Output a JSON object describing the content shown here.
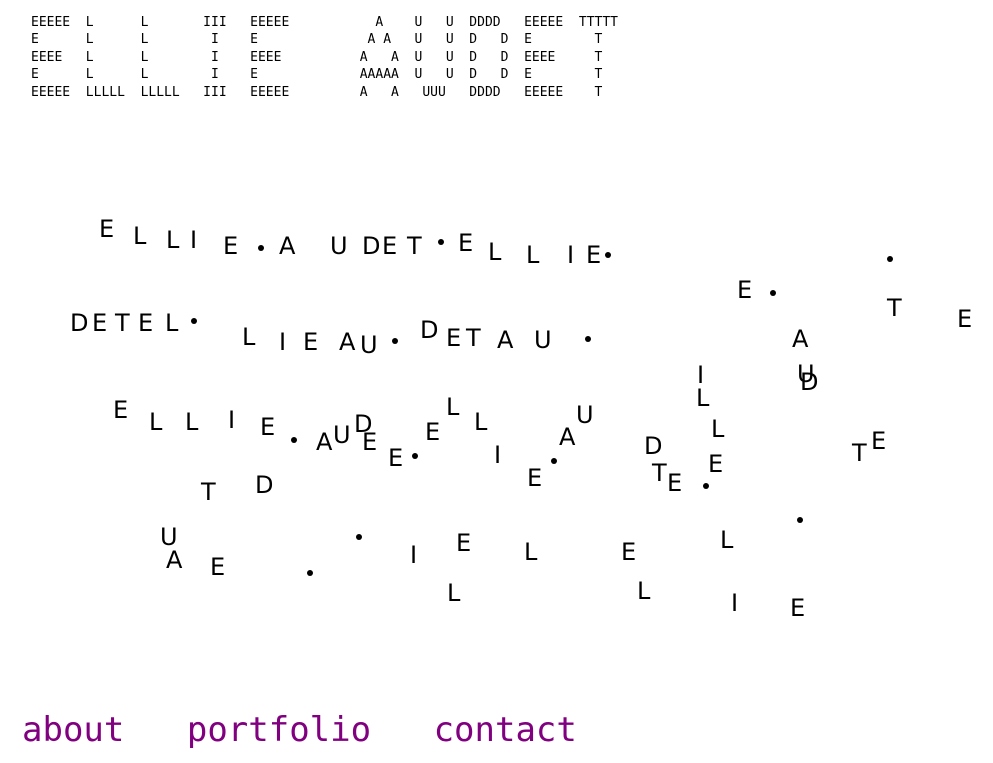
{
  "banner": {
    "ascii_art": "EEEEE  L      L       III   EEEEE           A    U   U  DDDD   EEEEE  TTTTT\nE      L      L        I    E              A A   U   U  D   D  E        T\nEEEE   L      L        I    EEEE          A   A  U   U  D   D  EEEE     T\nE      L      L        I    E             AAAAA  U   U  D   D  E        T\nEEEEE  LLLLL  LLLLL   III   EEEEE         A   A   UUU   DDDD   EEEEE    T"
  },
  "scatter_glyphs": [
    "E",
    "L",
    "L",
    "I",
    "E",
    "A",
    "U",
    "D",
    "E",
    "T",
    "E",
    "L",
    "L",
    "I",
    "E",
    "E",
    "T",
    "E",
    "A",
    "U",
    "D",
    "E",
    "T",
    "E",
    "L",
    "L",
    "I",
    "E",
    "A",
    "U",
    "D",
    "E",
    "T",
    "A",
    "U",
    "I",
    "D",
    "L",
    "E",
    "L",
    "L",
    "I",
    "E",
    "A",
    "U",
    "D",
    "E",
    "E",
    "L",
    "L",
    "I",
    "A",
    "U",
    "D",
    "L",
    "E",
    "T",
    "E",
    "E",
    "T",
    "E",
    "E",
    "T",
    "D",
    "U",
    "A",
    "E",
    "I",
    "E",
    "L",
    "L",
    "E",
    "L",
    "L",
    "I",
    "E"
  ],
  "nav": {
    "color": "#800080",
    "items": [
      {
        "label": "about"
      },
      {
        "label": "portfolio"
      },
      {
        "label": "contact"
      }
    ]
  }
}
